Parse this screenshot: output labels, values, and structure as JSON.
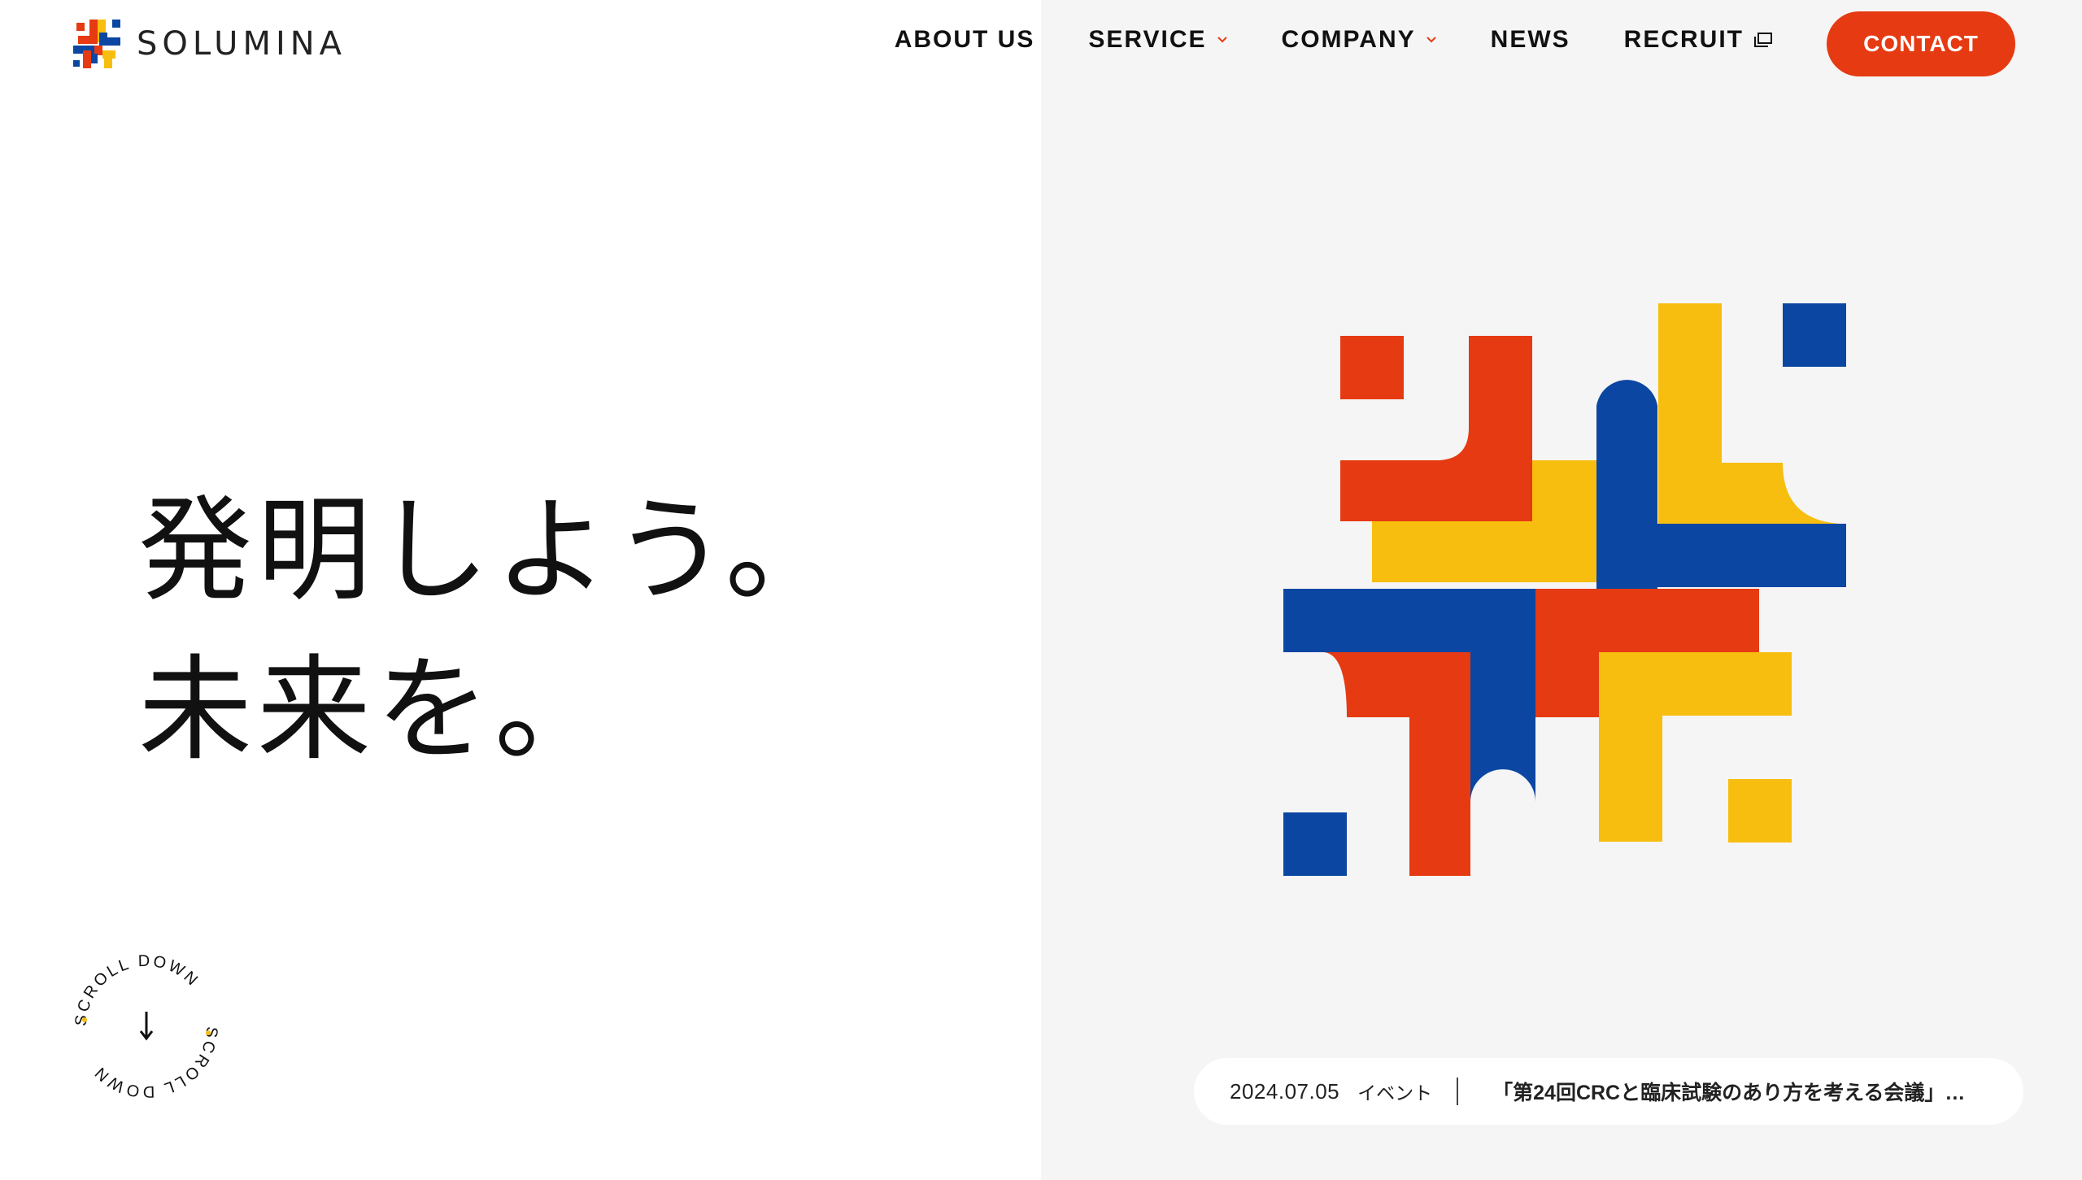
{
  "header": {
    "logo_text": "SOLUMINA",
    "nav": [
      {
        "label": "ABOUT US"
      },
      {
        "label": "SERVICE"
      },
      {
        "label": "COMPANY"
      },
      {
        "label": "NEWS"
      },
      {
        "label": "RECRUIT"
      }
    ],
    "contact_label": "CONTACT"
  },
  "hero": {
    "line1": "発明しよう。",
    "line2": "未来を。"
  },
  "scroll": {
    "label": "SCROLL DOWN"
  },
  "news": {
    "date": "2024.07.05",
    "category": "イベント",
    "title": "「第24回CRCと臨床試験のあり方を考える会議」…"
  },
  "colors": {
    "red": "#e63a12",
    "blue": "#0b47a2",
    "yellow": "#f7be0f",
    "panel": "#f5f5f5"
  }
}
